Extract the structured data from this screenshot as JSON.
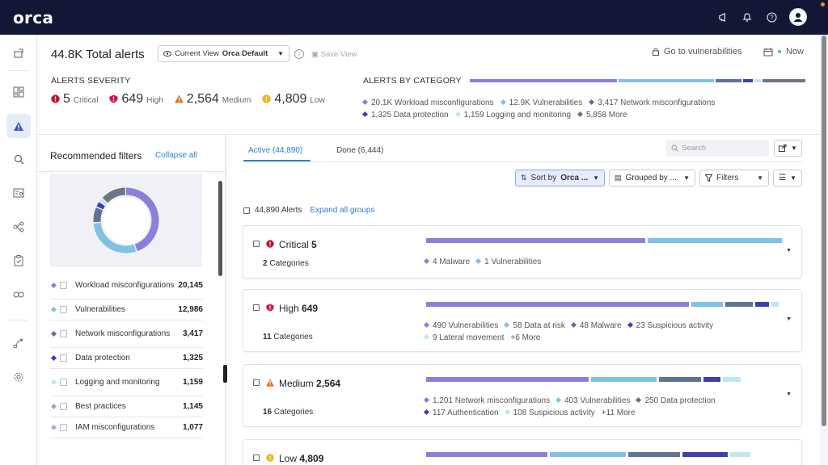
{
  "app": {
    "logo": "orca"
  },
  "header": {
    "title": "44.8K Total alerts",
    "view_prefix": "Current View",
    "view_name": "Orca Default",
    "save_view": "Save View",
    "goto_vulnerabilities": "Go to vulnerabilities",
    "now": "Now"
  },
  "severity": {
    "title": "ALERTS SEVERITY",
    "items": [
      {
        "count": "5",
        "label": "Critical",
        "color": "#c0162b"
      },
      {
        "count": "649",
        "label": "High",
        "color": "#d01a4a"
      },
      {
        "count": "2,564",
        "label": "Medium",
        "color": "#e56f1c"
      },
      {
        "count": "4,809",
        "label": "Low",
        "color": "#f0b323"
      }
    ]
  },
  "categories": {
    "title": "ALERTS BY CATEGORY",
    "legend": [
      {
        "text": "20.1K Workload misconfigurations",
        "color": "#8a80d8",
        "share": 0.45
      },
      {
        "text": "12.9K Vulnerabilities",
        "color": "#7fc2e2",
        "share": 0.29
      },
      {
        "text": "3,417 Network misconfigurations",
        "color": "#5f7397",
        "share": 0.08
      },
      {
        "text": "1,325 Data protection",
        "color": "#3f3fae",
        "share": 0.03
      },
      {
        "text": "1,159 Logging and monitoring",
        "color": "#bfe6f4",
        "share": 0.02
      },
      {
        "text": "5,858 More",
        "color": "#707584",
        "share": 0.13
      }
    ]
  },
  "filters": {
    "title": "Recommended filters",
    "collapse": "Collapse all",
    "items": [
      {
        "name": "Workload misconfigurations",
        "count": "20,145",
        "color": "#8a80d8"
      },
      {
        "name": "Vulnerabilities",
        "count": "12,986",
        "color": "#7fc2e2"
      },
      {
        "name": "Network misconfigurations",
        "count": "3,417",
        "color": "#5f7397"
      },
      {
        "name": "Data protection",
        "count": "1,325",
        "color": "#3f3fae"
      },
      {
        "name": "Logging and monitoring",
        "count": "1,159",
        "color": "#bfe6f4"
      },
      {
        "name": "Best practices",
        "count": "1,145",
        "color": "#9aa6c8"
      },
      {
        "name": "IAM misconfigurations",
        "count": "1,077",
        "color": "#b7a9ec"
      }
    ]
  },
  "main": {
    "tabs": [
      {
        "label": "Active (44,890)"
      },
      {
        "label": "Done (6,444)"
      }
    ],
    "search_placeholder": "Search",
    "sort_label": "Sort by",
    "sort_value": "Orca ...",
    "group_label": "Grouped by ...",
    "filters_label": "Filters",
    "alerts_count": "44,890 Alerts",
    "expand_all": "Expand all groups"
  },
  "groups": [
    {
      "severity": "Critical",
      "count": "5",
      "categories": "2",
      "categories_label": "Categories",
      "bar": [
        {
          "color": "#8a80d8",
          "share": 0.62
        },
        {
          "color": "#7fc2e2",
          "share": 0.38
        }
      ],
      "legend": [
        {
          "text": "4 Malware",
          "color": "#8a80d8"
        },
        {
          "text": "1 Vulnerabilities",
          "color": "#7fc2e2"
        }
      ]
    },
    {
      "severity": "High",
      "count": "649",
      "categories": "11",
      "categories_label": "Categories",
      "bar": [
        {
          "color": "#8a80d8",
          "share": 0.76
        },
        {
          "color": "#7fc2e2",
          "share": 0.09
        },
        {
          "color": "#5f7397",
          "share": 0.08
        },
        {
          "color": "#3f3fae",
          "share": 0.04
        },
        {
          "color": "#bfe6f4",
          "share": 0.02
        }
      ],
      "legend": [
        {
          "text": "490 Vulnerabilities",
          "color": "#8a80d8"
        },
        {
          "text": "58 Data at risk",
          "color": "#7fc2e2"
        },
        {
          "text": "48 Malware",
          "color": "#5f7397"
        },
        {
          "text": "23 Suspicious activity",
          "color": "#3f3fae"
        },
        {
          "text": "9 Lateral movement",
          "color": "#bfe6f4"
        },
        {
          "text": "+6 More",
          "color": ""
        }
      ]
    },
    {
      "severity": "Medium",
      "count": "2,564",
      "categories": "16",
      "categories_label": "Categories",
      "bar": [
        {
          "color": "#8a80d8",
          "share": 0.47
        },
        {
          "color": "#7fc2e2",
          "share": 0.19
        },
        {
          "color": "#5f7397",
          "share": 0.12
        },
        {
          "color": "#3f3fae",
          "share": 0.05
        },
        {
          "color": "#bfe6f4",
          "share": 0.05
        }
      ],
      "legend": [
        {
          "text": "1,201 Network misconfigurations",
          "color": "#8a80d8"
        },
        {
          "text": "403 Vulnerabilities",
          "color": "#7fc2e2"
        },
        {
          "text": "250 Data protection",
          "color": "#5f7397"
        },
        {
          "text": "117 Authentication",
          "color": "#3f3fae"
        },
        {
          "text": "108 Suspicious activity",
          "color": "#bfe6f4"
        },
        {
          "text": "+11 More",
          "color": ""
        }
      ]
    },
    {
      "severity": "Low",
      "count": "4,809",
      "bar": [
        {
          "color": "#8a80d8",
          "share": 0.35
        },
        {
          "color": "#7fc2e2",
          "share": 0.22
        },
        {
          "color": "#5f7397",
          "share": 0.15
        },
        {
          "color": "#3f3fae",
          "share": 0.13
        },
        {
          "color": "#bfe6f4",
          "share": 0.06
        }
      ]
    }
  ]
}
